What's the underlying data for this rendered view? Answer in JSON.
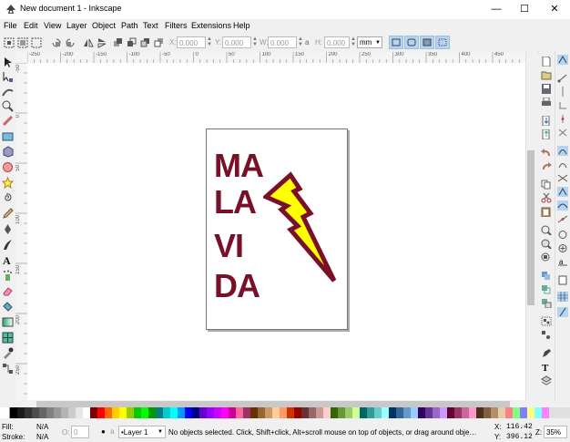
{
  "window": {
    "title": "New document 1 - Inkscape"
  },
  "window_controls": {
    "minimize": "—",
    "maximize": "☐",
    "close": "✕"
  },
  "menu": {
    "items": [
      "File",
      "Edit",
      "View",
      "Layer",
      "Object",
      "Path",
      "Text",
      "Filters",
      "Extensions",
      "Help"
    ]
  },
  "controls": {
    "x_label": "X:",
    "x_value": "0.000",
    "y_label": "Y:",
    "y_value": "0.000",
    "w_label": "W:",
    "w_value": "0.000",
    "lock_glyph": "a",
    "h_label": "H:",
    "h_value": "0.000",
    "unit": "mm"
  },
  "ruler_labels": [
    "-250",
    "-200",
    "-150",
    "-100",
    "-50",
    "0",
    "50",
    "100",
    "150",
    "200",
    "250",
    "300",
    "350",
    "400",
    "450"
  ],
  "vruler_labels": [
    "-50",
    "0",
    "50",
    "100",
    "150",
    "200",
    "250"
  ],
  "artwork": {
    "words": [
      "MA",
      "LA",
      "VI",
      "DA"
    ],
    "text_color": "#7a1027",
    "bolt_fill": "#ffff00",
    "bolt_stroke": "#7a1027"
  },
  "palette": [
    "#000000",
    "#1a1a1a",
    "#333333",
    "#4d4d4d",
    "#666666",
    "#808080",
    "#999999",
    "#b3b3b3",
    "#cccccc",
    "#e6e6e6",
    "#ffffff",
    "#800000",
    "#ff0000",
    "#ff6600",
    "#ffcc00",
    "#ffff00",
    "#99cc00",
    "#00cc00",
    "#00ff00",
    "#009900",
    "#008080",
    "#00cccc",
    "#00ffff",
    "#0099ff",
    "#0000ff",
    "#000080",
    "#6600cc",
    "#9900ff",
    "#cc00ff",
    "#ff00ff",
    "#cc0099",
    "#ff6699",
    "#993366",
    "#663300",
    "#996633",
    "#cc9966",
    "#ffcc99",
    "#ff9966",
    "#cc3300",
    "#990000",
    "#663333",
    "#996666",
    "#cc9999",
    "#ffcccc",
    "#336600",
    "#669933",
    "#99cc66",
    "#ccff99",
    "#006666",
    "#339999",
    "#66cccc",
    "#99ffff",
    "#003366",
    "#336699",
    "#6699cc",
    "#99ccff",
    "#330066",
    "#663399",
    "#9966cc",
    "#cc99ff",
    "#660033",
    "#993366",
    "#cc6699",
    "#ff99cc",
    "#4d3319",
    "#806040",
    "#b38f66",
    "#e6cca8",
    "#ff8080",
    "#80ff80",
    "#8080ff",
    "#ffff80",
    "#80ffff",
    "#ff80ff"
  ],
  "status": {
    "fill_label": "Fill:",
    "fill_value": "N/A",
    "stroke_label": "Stroke:",
    "stroke_value": "N/A",
    "opacity_label": "O:",
    "opacity_value": "0",
    "layer": "•Layer 1",
    "message": "No objects selected. Click, Shift+click, Alt+scroll mouse on top of objects, or drag around obje…",
    "x_label": "X:",
    "x_value": "116.42",
    "y_label": "Y:",
    "y_value": "396.12",
    "z_label": "Z:",
    "zoom": "35%"
  }
}
